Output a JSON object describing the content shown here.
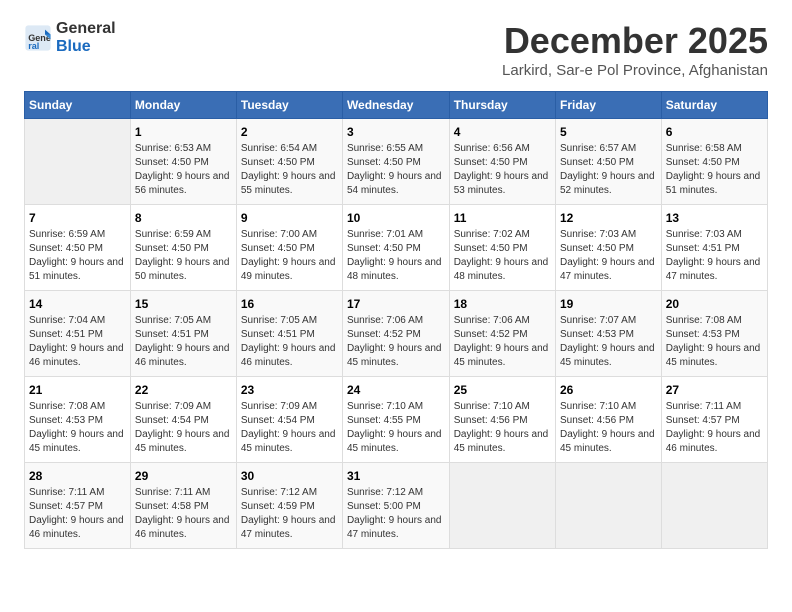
{
  "header": {
    "logo_general": "General",
    "logo_blue": "Blue",
    "title": "December 2025",
    "subtitle": "Larkird, Sar-e Pol Province, Afghanistan"
  },
  "days_of_week": [
    "Sunday",
    "Monday",
    "Tuesday",
    "Wednesday",
    "Thursday",
    "Friday",
    "Saturday"
  ],
  "weeks": [
    [
      {
        "day": "",
        "sunrise": "",
        "sunset": "",
        "daylight": ""
      },
      {
        "day": "1",
        "sunrise": "Sunrise: 6:53 AM",
        "sunset": "Sunset: 4:50 PM",
        "daylight": "Daylight: 9 hours and 56 minutes."
      },
      {
        "day": "2",
        "sunrise": "Sunrise: 6:54 AM",
        "sunset": "Sunset: 4:50 PM",
        "daylight": "Daylight: 9 hours and 55 minutes."
      },
      {
        "day": "3",
        "sunrise": "Sunrise: 6:55 AM",
        "sunset": "Sunset: 4:50 PM",
        "daylight": "Daylight: 9 hours and 54 minutes."
      },
      {
        "day": "4",
        "sunrise": "Sunrise: 6:56 AM",
        "sunset": "Sunset: 4:50 PM",
        "daylight": "Daylight: 9 hours and 53 minutes."
      },
      {
        "day": "5",
        "sunrise": "Sunrise: 6:57 AM",
        "sunset": "Sunset: 4:50 PM",
        "daylight": "Daylight: 9 hours and 52 minutes."
      },
      {
        "day": "6",
        "sunrise": "Sunrise: 6:58 AM",
        "sunset": "Sunset: 4:50 PM",
        "daylight": "Daylight: 9 hours and 51 minutes."
      }
    ],
    [
      {
        "day": "7",
        "sunrise": "Sunrise: 6:59 AM",
        "sunset": "Sunset: 4:50 PM",
        "daylight": "Daylight: 9 hours and 51 minutes."
      },
      {
        "day": "8",
        "sunrise": "Sunrise: 6:59 AM",
        "sunset": "Sunset: 4:50 PM",
        "daylight": "Daylight: 9 hours and 50 minutes."
      },
      {
        "day": "9",
        "sunrise": "Sunrise: 7:00 AM",
        "sunset": "Sunset: 4:50 PM",
        "daylight": "Daylight: 9 hours and 49 minutes."
      },
      {
        "day": "10",
        "sunrise": "Sunrise: 7:01 AM",
        "sunset": "Sunset: 4:50 PM",
        "daylight": "Daylight: 9 hours and 48 minutes."
      },
      {
        "day": "11",
        "sunrise": "Sunrise: 7:02 AM",
        "sunset": "Sunset: 4:50 PM",
        "daylight": "Daylight: 9 hours and 48 minutes."
      },
      {
        "day": "12",
        "sunrise": "Sunrise: 7:03 AM",
        "sunset": "Sunset: 4:50 PM",
        "daylight": "Daylight: 9 hours and 47 minutes."
      },
      {
        "day": "13",
        "sunrise": "Sunrise: 7:03 AM",
        "sunset": "Sunset: 4:51 PM",
        "daylight": "Daylight: 9 hours and 47 minutes."
      }
    ],
    [
      {
        "day": "14",
        "sunrise": "Sunrise: 7:04 AM",
        "sunset": "Sunset: 4:51 PM",
        "daylight": "Daylight: 9 hours and 46 minutes."
      },
      {
        "day": "15",
        "sunrise": "Sunrise: 7:05 AM",
        "sunset": "Sunset: 4:51 PM",
        "daylight": "Daylight: 9 hours and 46 minutes."
      },
      {
        "day": "16",
        "sunrise": "Sunrise: 7:05 AM",
        "sunset": "Sunset: 4:51 PM",
        "daylight": "Daylight: 9 hours and 46 minutes."
      },
      {
        "day": "17",
        "sunrise": "Sunrise: 7:06 AM",
        "sunset": "Sunset: 4:52 PM",
        "daylight": "Daylight: 9 hours and 45 minutes."
      },
      {
        "day": "18",
        "sunrise": "Sunrise: 7:06 AM",
        "sunset": "Sunset: 4:52 PM",
        "daylight": "Daylight: 9 hours and 45 minutes."
      },
      {
        "day": "19",
        "sunrise": "Sunrise: 7:07 AM",
        "sunset": "Sunset: 4:53 PM",
        "daylight": "Daylight: 9 hours and 45 minutes."
      },
      {
        "day": "20",
        "sunrise": "Sunrise: 7:08 AM",
        "sunset": "Sunset: 4:53 PM",
        "daylight": "Daylight: 9 hours and 45 minutes."
      }
    ],
    [
      {
        "day": "21",
        "sunrise": "Sunrise: 7:08 AM",
        "sunset": "Sunset: 4:53 PM",
        "daylight": "Daylight: 9 hours and 45 minutes."
      },
      {
        "day": "22",
        "sunrise": "Sunrise: 7:09 AM",
        "sunset": "Sunset: 4:54 PM",
        "daylight": "Daylight: 9 hours and 45 minutes."
      },
      {
        "day": "23",
        "sunrise": "Sunrise: 7:09 AM",
        "sunset": "Sunset: 4:54 PM",
        "daylight": "Daylight: 9 hours and 45 minutes."
      },
      {
        "day": "24",
        "sunrise": "Sunrise: 7:10 AM",
        "sunset": "Sunset: 4:55 PM",
        "daylight": "Daylight: 9 hours and 45 minutes."
      },
      {
        "day": "25",
        "sunrise": "Sunrise: 7:10 AM",
        "sunset": "Sunset: 4:56 PM",
        "daylight": "Daylight: 9 hours and 45 minutes."
      },
      {
        "day": "26",
        "sunrise": "Sunrise: 7:10 AM",
        "sunset": "Sunset: 4:56 PM",
        "daylight": "Daylight: 9 hours and 45 minutes."
      },
      {
        "day": "27",
        "sunrise": "Sunrise: 7:11 AM",
        "sunset": "Sunset: 4:57 PM",
        "daylight": "Daylight: 9 hours and 46 minutes."
      }
    ],
    [
      {
        "day": "28",
        "sunrise": "Sunrise: 7:11 AM",
        "sunset": "Sunset: 4:57 PM",
        "daylight": "Daylight: 9 hours and 46 minutes."
      },
      {
        "day": "29",
        "sunrise": "Sunrise: 7:11 AM",
        "sunset": "Sunset: 4:58 PM",
        "daylight": "Daylight: 9 hours and 46 minutes."
      },
      {
        "day": "30",
        "sunrise": "Sunrise: 7:12 AM",
        "sunset": "Sunset: 4:59 PM",
        "daylight": "Daylight: 9 hours and 47 minutes."
      },
      {
        "day": "31",
        "sunrise": "Sunrise: 7:12 AM",
        "sunset": "Sunset: 5:00 PM",
        "daylight": "Daylight: 9 hours and 47 minutes."
      },
      {
        "day": "",
        "sunrise": "",
        "sunset": "",
        "daylight": ""
      },
      {
        "day": "",
        "sunrise": "",
        "sunset": "",
        "daylight": ""
      },
      {
        "day": "",
        "sunrise": "",
        "sunset": "",
        "daylight": ""
      }
    ]
  ]
}
